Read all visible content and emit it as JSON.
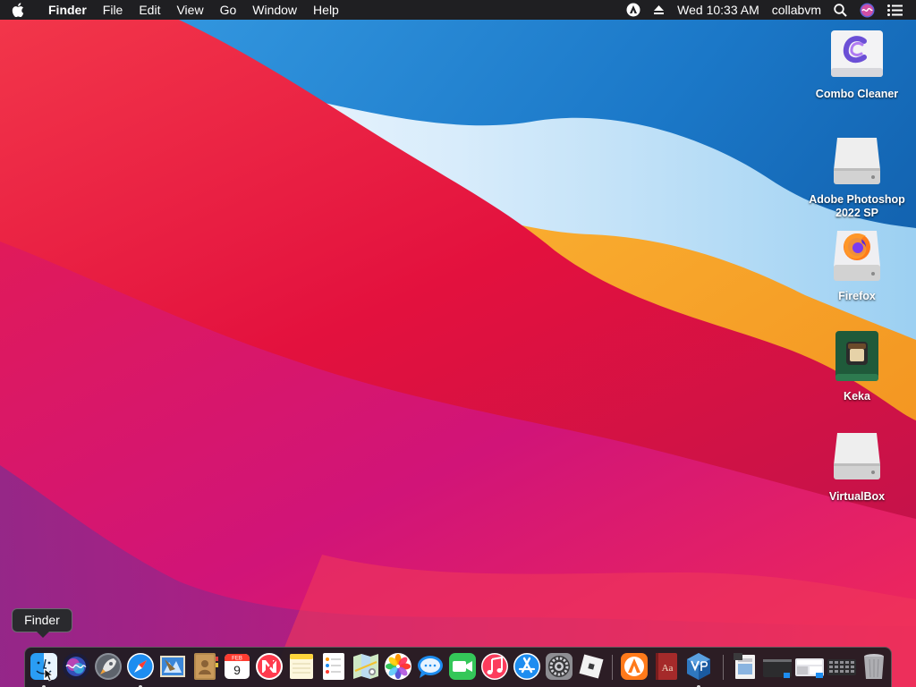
{
  "menubar": {
    "app_name": "Finder",
    "menus": [
      "File",
      "Edit",
      "View",
      "Go",
      "Window",
      "Help"
    ],
    "clock": "Wed 10:33 AM",
    "user": "collabvm"
  },
  "desktop": {
    "icons": [
      {
        "label": "Combo Cleaner",
        "icon": "combo-cleaner-icon"
      },
      {
        "label": "Adobe Photoshop 2022 SP",
        "icon": "disk-drive-icon"
      },
      {
        "label": "Firefox",
        "icon": "firefox-disk-icon"
      },
      {
        "label": "Keka",
        "icon": "keka-disk-icon"
      },
      {
        "label": "VirtualBox",
        "icon": "disk-drive-icon"
      }
    ]
  },
  "dock": {
    "tooltip": "Finder",
    "calendar_month": "FEB",
    "calendar_day": "9",
    "dictionary_glyph": "Aa",
    "items": [
      "Finder",
      "Siri",
      "Launchpad",
      "Safari",
      "Mail",
      "Contacts",
      "Calendar",
      "News",
      "Notes",
      "Reminders",
      "Maps",
      "Photos",
      "Messages",
      "FaceTime",
      "Music",
      "App Store",
      "System Preferences",
      "Roblox",
      "Avast",
      "Dictionary",
      "VirtualBox",
      "Preview",
      "Terminal",
      "Screenshot",
      "Calculator",
      "Trash"
    ]
  },
  "colors": {
    "menubar_bg": "#1f1f22",
    "dock_bg": "#1c1c20",
    "wallpaper_red": "#e8143f",
    "wallpaper_blue": "#1e7fd0",
    "wallpaper_orange": "#f6a11c"
  }
}
